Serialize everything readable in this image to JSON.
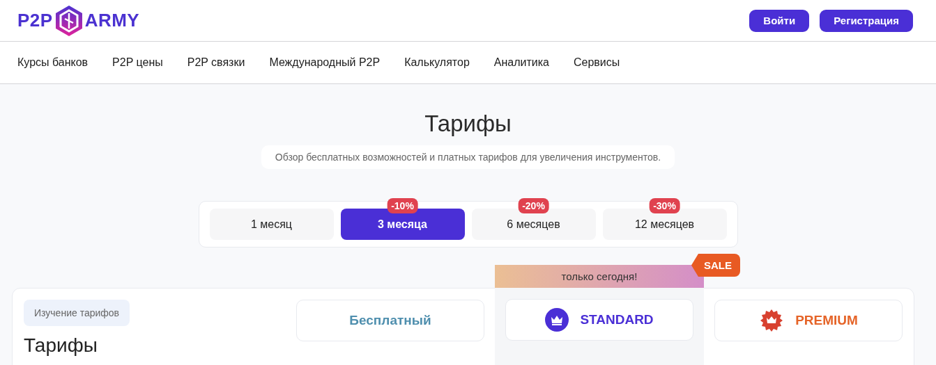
{
  "header": {
    "logo_left": "P2P",
    "logo_right": "ARMY",
    "buttons": [
      "Войти",
      "Регистрация"
    ]
  },
  "nav": [
    "Курсы банков",
    "P2P цены",
    "P2P связки",
    "Международный P2P",
    "Калькулятор",
    "Аналитика",
    "Сервисы"
  ],
  "page": {
    "title": "Тарифы",
    "subtitle": "Обзор бесплатных возможностей и платных тарифов для увеличения инструментов."
  },
  "periods": [
    {
      "label": "1 месяц",
      "selected": false
    },
    {
      "label": "3 месяца",
      "selected": true,
      "discount": "-10%"
    },
    {
      "label": "6 месяцев",
      "selected": false,
      "discount": "-20%"
    },
    {
      "label": "12 месяцев",
      "selected": false,
      "discount": "-30%"
    }
  ],
  "card": {
    "tag": "Изучение тарифов",
    "heading": "Тарифы"
  },
  "plans": [
    {
      "kind": "free",
      "name": "Бесплатный"
    },
    {
      "kind": "standard",
      "name": "STANDARD",
      "banner": "только сегодня!",
      "sale": "SALE"
    },
    {
      "kind": "premium",
      "name": "PREMIUM"
    }
  ]
}
